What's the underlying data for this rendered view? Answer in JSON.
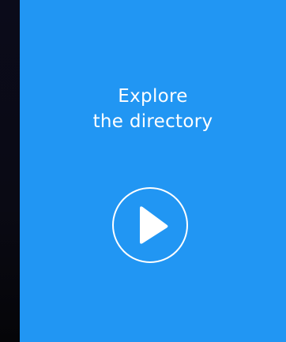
{
  "card": {
    "title_line1": "Explore",
    "title_line2": "the directory",
    "background_color": "#2196f3",
    "text_color": "#ffffff"
  },
  "play_button": {
    "icon": "play-icon"
  }
}
